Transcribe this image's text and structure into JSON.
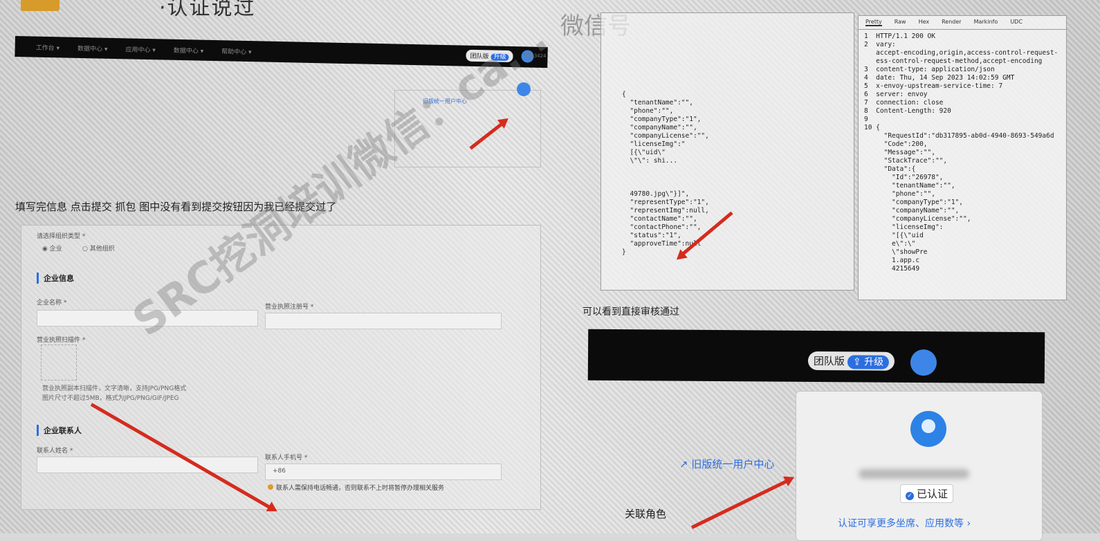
{
  "top": {
    "title": "·认证说过",
    "watermark": "微信号"
  },
  "nav": {
    "menu": [
      "工作台 ▾",
      "数据中心 ▾",
      "应用中心 ▾",
      "数据中心 ▾",
      "帮助中心 ▾"
    ],
    "version": "团队版",
    "upgrade": "升级",
    "number": "13424"
  },
  "left_panel": {
    "link": "旧版统一用户中心"
  },
  "question": "填写完信息 点击提交 抓包 图中没有看到提交按钮因为我已经提交过了",
  "form": {
    "org_type_label": "请选择组织类型 *",
    "org_options": [
      "企业",
      "其他组织"
    ],
    "company_section": "企业信息",
    "company_name_label": "企业名称 *",
    "license_no_label": "营业执照注册号 *",
    "license_img_label": "营业执照扫描件 *",
    "upload_hint1": "营业执照副本扫描件，文字清晰，支持JPG/PNG格式",
    "upload_hint2": "图片尺寸不超过5MB，格式为JPG/PNG/GIF/JPEG",
    "contact_section": "企业联系人",
    "contact_name_label": "联系人姓名 *",
    "contact_phone_label": "联系人手机号 *",
    "phone_prefix": "+86",
    "warning": "联系人需保持电话畅通，否则联系不上时将暂停办理相关服务"
  },
  "watermark_diag": "SRC挖洞培训微信：ca...",
  "request_body": "{\n  \"tenantName\":\"\",\n  \"phone\":\"\",\n  \"companyType\":\"1\",\n  \"companyName\":\"\",\n  \"companyLicense\":\"\",\n  \"licenseImg\":\"\n  [{\\\"uid\\\"\n  \\\"\\\": shi...\n\n\n\n  49780.jpg\\\"}]\",\n  \"representType\":\"1\",\n  \"representImg\":null,\n  \"contactName\":\"\",\n  \"contactPhone\":\"\",\n  \"status\":\"1\",\n  \"approveTime\":null\n}",
  "response": {
    "tabs": [
      "Pretty",
      "Raw",
      "Hex",
      "Render",
      "Markinfo",
      "UDC"
    ],
    "body": "1  HTTP/1.1 200 OK\n2  vary:\n   accept-encoding,origin,access-control-request-\n   ess-control-request-method,accept-encoding\n3  content-type: application/json\n4  date: Thu, 14 Sep 2023 14:02:59 GMT\n5  x-envoy-upstream-service-time: 7\n6  server: envoy\n7  connection: close\n8  Content-Length: 920\n9\n10 {\n     \"RequestId\":\"db317895-ab0d-4940-8693-549a6d\n     \"Code\":200,\n     \"Message\":\"\",\n     \"StackTrace\":\"\",\n     \"Data\":{\n       \"Id\":\"26978\",\n       \"tenantName\":\"\",\n       \"phone\":\"\",\n       \"companyType\":\"1\",\n       \"companyName\":\"\",\n       \"companyLicense\":\"\",\n       \"licenseImg\":\n       \"[{\\\"uid\n       e\\\":\\\"\n       \\\"showPre\n       1.app.c\n       4215649"
  },
  "caption2": "可以看到直接审核通过",
  "bar2": {
    "version": "团队版",
    "upgrade": "升级"
  },
  "user_card": {
    "badge": "已认证",
    "more": "认证可享更多坐席、应用数等 ›"
  },
  "old_center_link": "旧版统一用户中心",
  "role_label": "关联角色",
  "colors": {
    "accent": "#2c6ee0",
    "arrow": "#d52b1e",
    "dark_bar": "#0b0b0b"
  }
}
